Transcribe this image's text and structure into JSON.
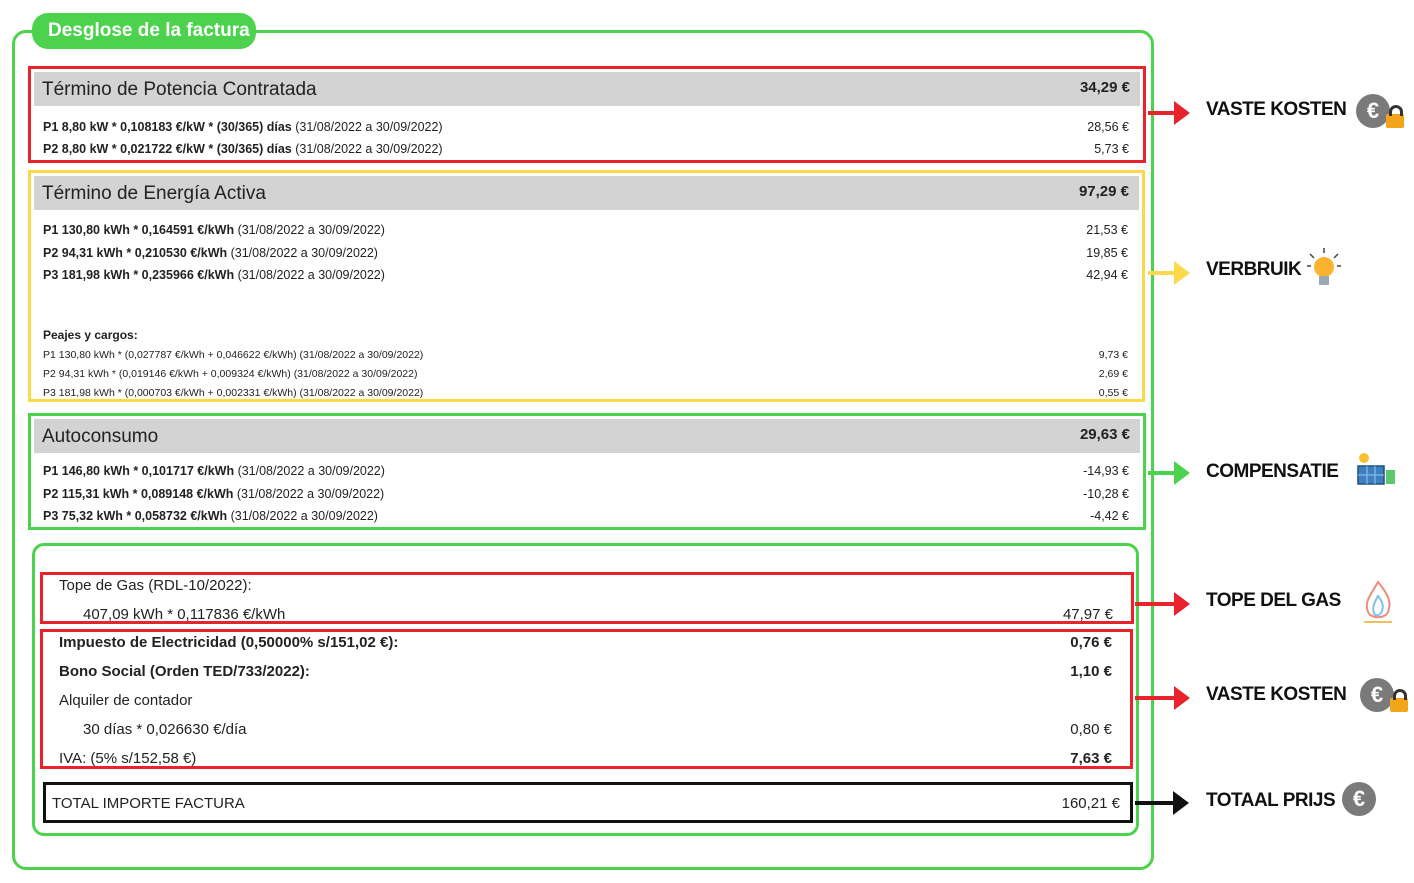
{
  "title": "Desglose de la factura",
  "potencia": {
    "title": "Término de Potencia Contratada",
    "total": "34,29 €",
    "lines": [
      {
        "bold": "P1 8,80 kW * 0,108183 €/kW * (30/365) días",
        "rest": " (31/08/2022 a 30/09/2022)",
        "value": "28,56 €"
      },
      {
        "bold": "P2 8,80 kW * 0,021722 €/kW * (30/365) días",
        "rest": " (31/08/2022 a 30/09/2022)",
        "value": "5,73 €"
      }
    ]
  },
  "energia": {
    "title": "Término de Energía Activa",
    "total": "97,29 €",
    "lines": [
      {
        "bold": "P1 130,80 kWh * 0,164591 €/kWh",
        "rest": " (31/08/2022 a 30/09/2022)",
        "value": "21,53 €"
      },
      {
        "bold": "P2 94,31 kWh * 0,210530 €/kWh",
        "rest": " (31/08/2022 a 30/09/2022)",
        "value": "19,85 €"
      },
      {
        "bold": "P3 181,98 kWh * 0,235966 €/kWh",
        "rest": " (31/08/2022 a 30/09/2022)",
        "value": "42,94 €"
      }
    ],
    "peajes_title": "Peajes y cargos:",
    "peajes": [
      {
        "text": "P1 130,80 kWh * (0,027787 €/kWh + 0,046622 €/kWh) (31/08/2022 a 30/09/2022)",
        "value": "9,73 €"
      },
      {
        "text": "P2 94,31 kWh * (0,019146 €/kWh + 0,009324 €/kWh) (31/08/2022 a 30/09/2022)",
        "value": "2,69 €"
      },
      {
        "text": "P3 181,98 kWh * (0,000703 €/kWh + 0,002331 €/kWh) (31/08/2022 a 30/09/2022)",
        "value": "0,55 €"
      }
    ]
  },
  "autoconsumo": {
    "title": "Autoconsumo",
    "total": "29,63 €",
    "lines": [
      {
        "bold": "P1 146,80 kWh * 0,101717 €/kWh",
        "rest": " (31/08/2022 a 30/09/2022)",
        "value": "-14,93 €"
      },
      {
        "bold": "P2 115,31 kWh * 0,089148 €/kWh",
        "rest": " (31/08/2022 a 30/09/2022)",
        "value": "-10,28 €"
      },
      {
        "bold": "P3 75,32 kWh * 0,058732 €/kWh",
        "rest": " (31/08/2022 a 30/09/2022)",
        "value": "-4,42 €"
      }
    ]
  },
  "gas": {
    "title": "Tope de Gas (RDL-10/2022):",
    "detail": "407,09 kWh * 0,117836 €/kWh",
    "value": "47,97 €"
  },
  "otros": {
    "impuesto": {
      "label": "Impuesto de Electricidad (0,50000% s/151,02 €):",
      "value": "0,76 €"
    },
    "bono": {
      "label": "Bono Social (Orden TED/733/2022):",
      "value": "1,10 €"
    },
    "alquiler": {
      "label": "Alquiler de contador",
      "detail": "30 días * 0,026630 €/día",
      "value": "0,80 €"
    },
    "iva": {
      "label": "IVA: (5% s/152,58 €)",
      "value": "7,63 €"
    }
  },
  "total": {
    "label": "TOTAL IMPORTE FACTURA",
    "value": "160,21 €"
  },
  "annotations": {
    "vaste1": "VASTE KOSTEN",
    "verbruik": "VERBRUIK",
    "compensatie": "COMPENSATIE",
    "gas": "TOPE  DEL GAS",
    "vaste2": "VASTE KOSTEN",
    "totaal": "TOTAAL PRIJS",
    "euro_symbol": "€"
  },
  "colors": {
    "green": "#4cd24c",
    "red": "#e8232b",
    "yellow": "#fcd94b",
    "black": "#111111",
    "header_gray": "#d3d3d3"
  },
  "icons": [
    "euro-lock-icon",
    "lightbulb-icon",
    "solar-panel-icon",
    "gas-flame-icon",
    "euro-lock-icon",
    "euro-icon"
  ]
}
